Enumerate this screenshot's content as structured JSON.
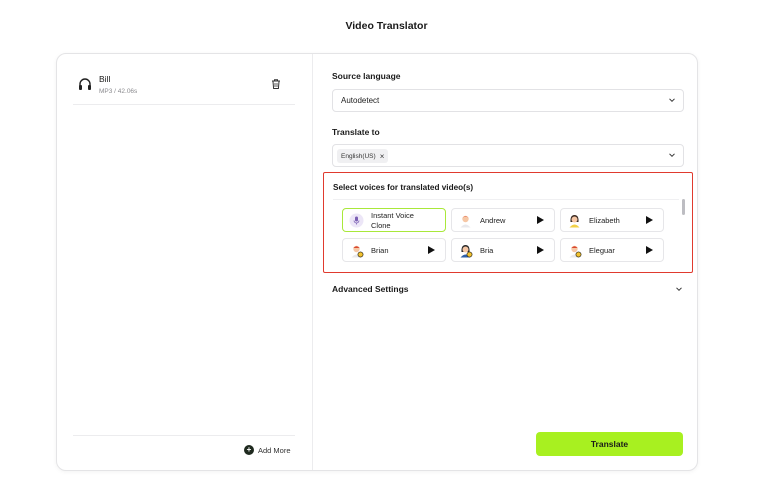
{
  "app": {
    "title": "Video Translator"
  },
  "file": {
    "name": "Bill",
    "meta": "MP3 / 42.06s",
    "icon": "headphones-icon"
  },
  "add_more": {
    "label": "Add More"
  },
  "source_language": {
    "label": "Source language",
    "value": "Autodetect"
  },
  "translate_to": {
    "label": "Translate to",
    "tags": [
      "English(US)"
    ]
  },
  "voices": {
    "title": "Select voices for translated video(s)",
    "items": [
      {
        "name": "Instant Voice Clone",
        "selected": true,
        "has_play": false
      },
      {
        "name": "Andrew",
        "selected": false,
        "has_play": true
      },
      {
        "name": "Elizabeth",
        "selected": false,
        "has_play": true
      },
      {
        "name": "Brian",
        "selected": false,
        "has_play": true
      },
      {
        "name": "Bria",
        "selected": false,
        "has_play": true
      },
      {
        "name": "Eleguar",
        "selected": false,
        "has_play": true
      }
    ]
  },
  "advanced": {
    "label": "Advanced Settings"
  },
  "translate_button": {
    "label": "Translate"
  },
  "colors": {
    "accent": "#a8f020",
    "highlight_border": "#e03a2e",
    "selected_border": "#a9e83a"
  }
}
